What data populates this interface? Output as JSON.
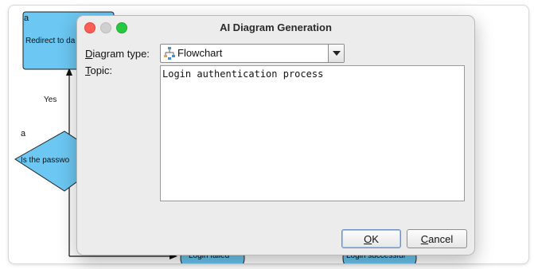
{
  "background_diagram": {
    "node_redirect": "Redirect to da",
    "node_password": "Is the passwo",
    "node_login_failed": "Login failed",
    "node_login_successful": "Login successful",
    "edge_label_yes": "Yes",
    "corner_label_top": "a",
    "corner_label_mid": "a",
    "colors": {
      "node_fill": "#6cc7f2",
      "node_stroke": "#222222"
    }
  },
  "dialog": {
    "title": "AI Diagram Generation",
    "diagram_type_label": "Diagram type:",
    "diagram_type_mnemonic": "D",
    "diagram_type_rest": "iagram type:",
    "diagram_type_value": "Flowchart",
    "diagram_type_icon": "flowchart-icon",
    "topic_mnemonic": "T",
    "topic_rest": "opic:",
    "topic_value": "Login authentication process",
    "ok_mnemonic": "O",
    "ok_rest": "K",
    "cancel_mnemonic": "C",
    "cancel_rest": "ancel",
    "colors": {
      "close": "#ff5f57",
      "minimize": "#d0d0d0",
      "maximize": "#28c840",
      "default_button_ring": "#a9c3e8"
    }
  }
}
